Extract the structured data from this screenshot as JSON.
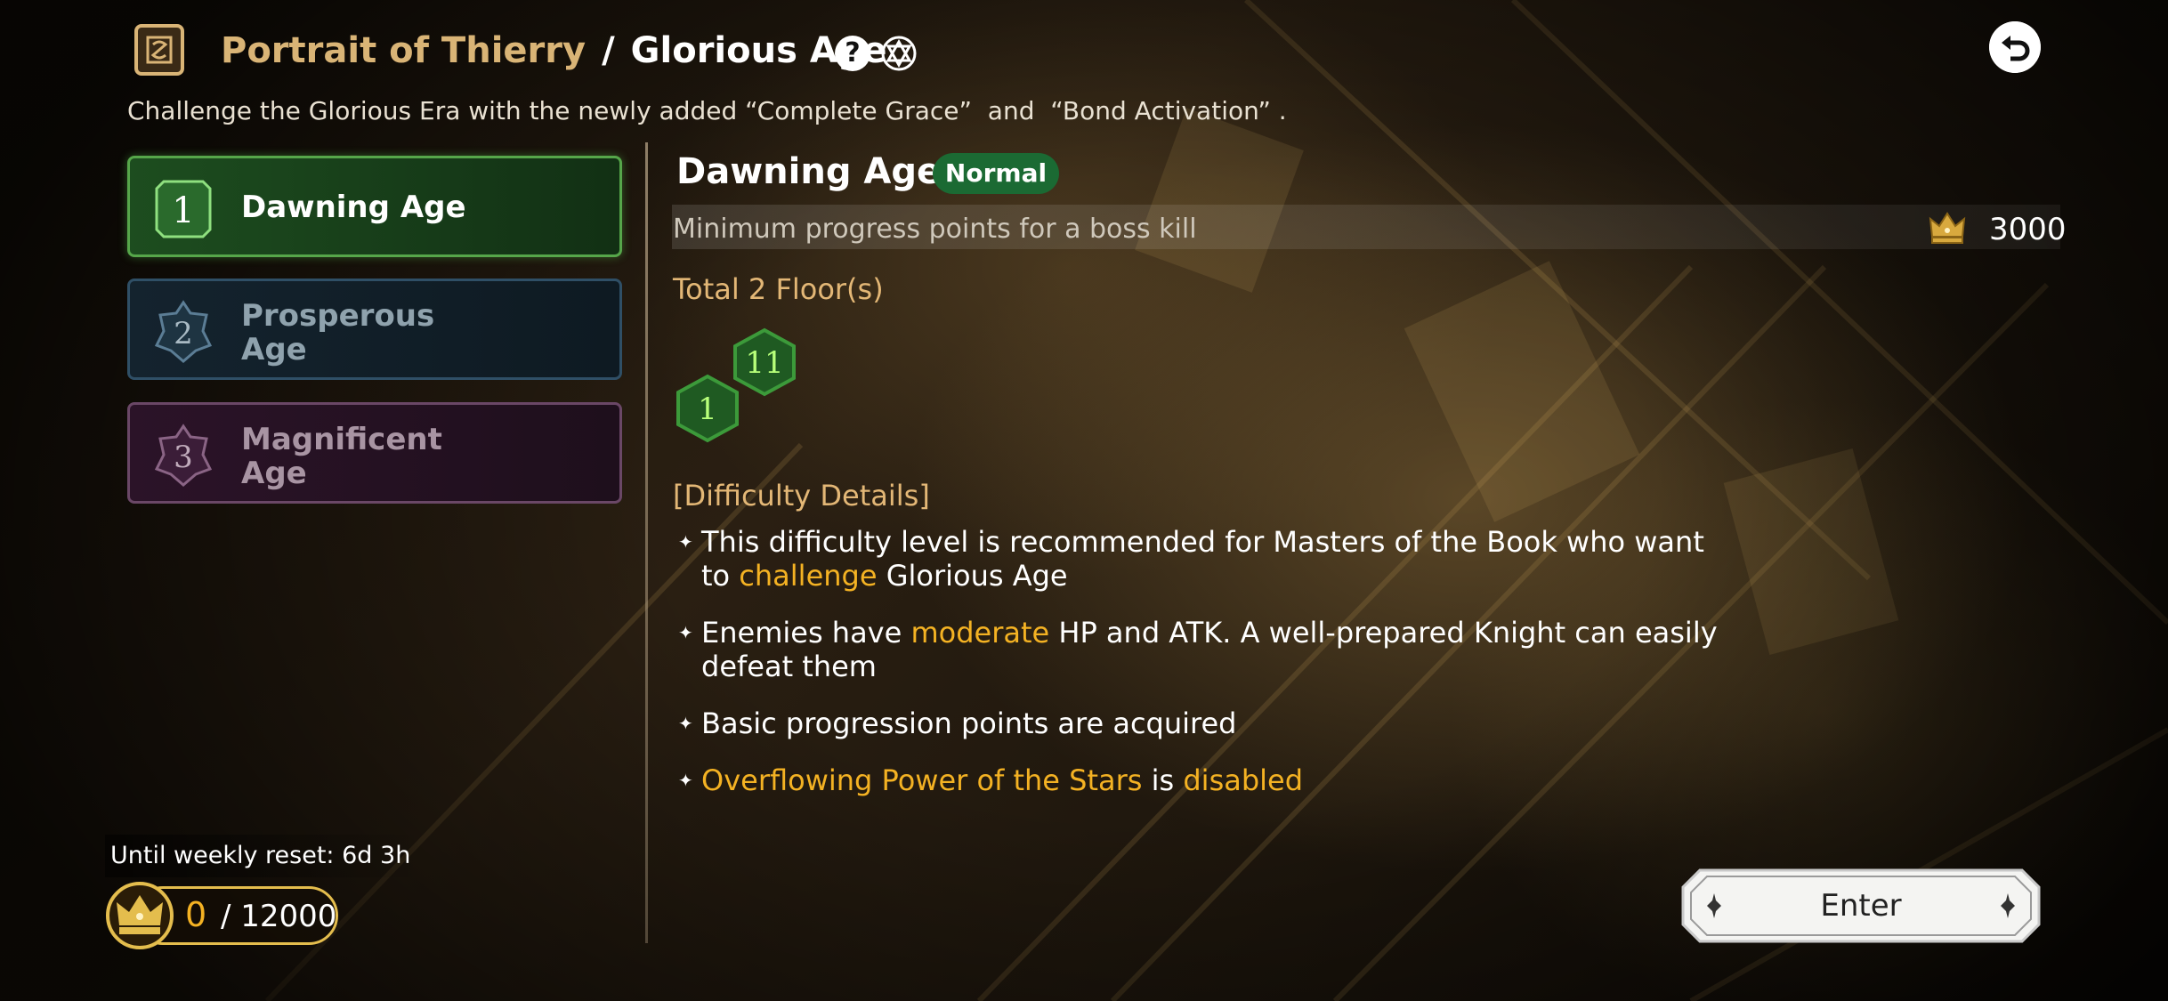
{
  "header": {
    "breadcrumb_primary": "Portrait of Thierry",
    "breadcrumb_separator": "/",
    "breadcrumb_secondary": "Glorious Age",
    "help_icon": "?",
    "subtitle": "Challenge the Glorious Era with the newly added “Complete Grace”  and  “Bond Activation” ."
  },
  "tabs": [
    {
      "number": "1",
      "label": "Dawning Age",
      "state": "selected"
    },
    {
      "number": "2",
      "label_line1": "Prosperous",
      "label_line2": "Age",
      "state": "unselected"
    },
    {
      "number": "3",
      "label_line1": "Magnificent",
      "label_line2": "Age",
      "state": "unselected"
    }
  ],
  "detail": {
    "title": "Dawning Age",
    "difficulty_badge": "Normal",
    "progress_label": "Minimum progress points for a boss kill",
    "progress_value": "3000",
    "floors_label": "Total 2 Floor(s)",
    "floor_badges": [
      "1",
      "11"
    ],
    "difficulty_header": "[Difficulty Details]",
    "bullets": [
      {
        "parts": [
          "This difficulty level is recommended for Masters of the Book who want to ",
          "challenge",
          " Glorious Age"
        ]
      },
      {
        "parts": [
          "Enemies have ",
          "moderate",
          " HP and ATK. A well-prepared Knight can easily defeat them"
        ]
      },
      {
        "parts": [
          "Basic progression points are acquired"
        ]
      },
      {
        "parts": [
          "Overflowing Power of the Stars",
          " is ",
          "disabled"
        ]
      }
    ]
  },
  "footer": {
    "reset_text": "Until weekly reset: 6d 3h",
    "score_current": "0",
    "score_total": "/ 12000",
    "enter_label": "Enter"
  },
  "colors": {
    "accent_gold": "#f4b223",
    "title_gold": "#d9b476",
    "selected_green": "#56a64a",
    "badge_green": "#1b6a33"
  }
}
